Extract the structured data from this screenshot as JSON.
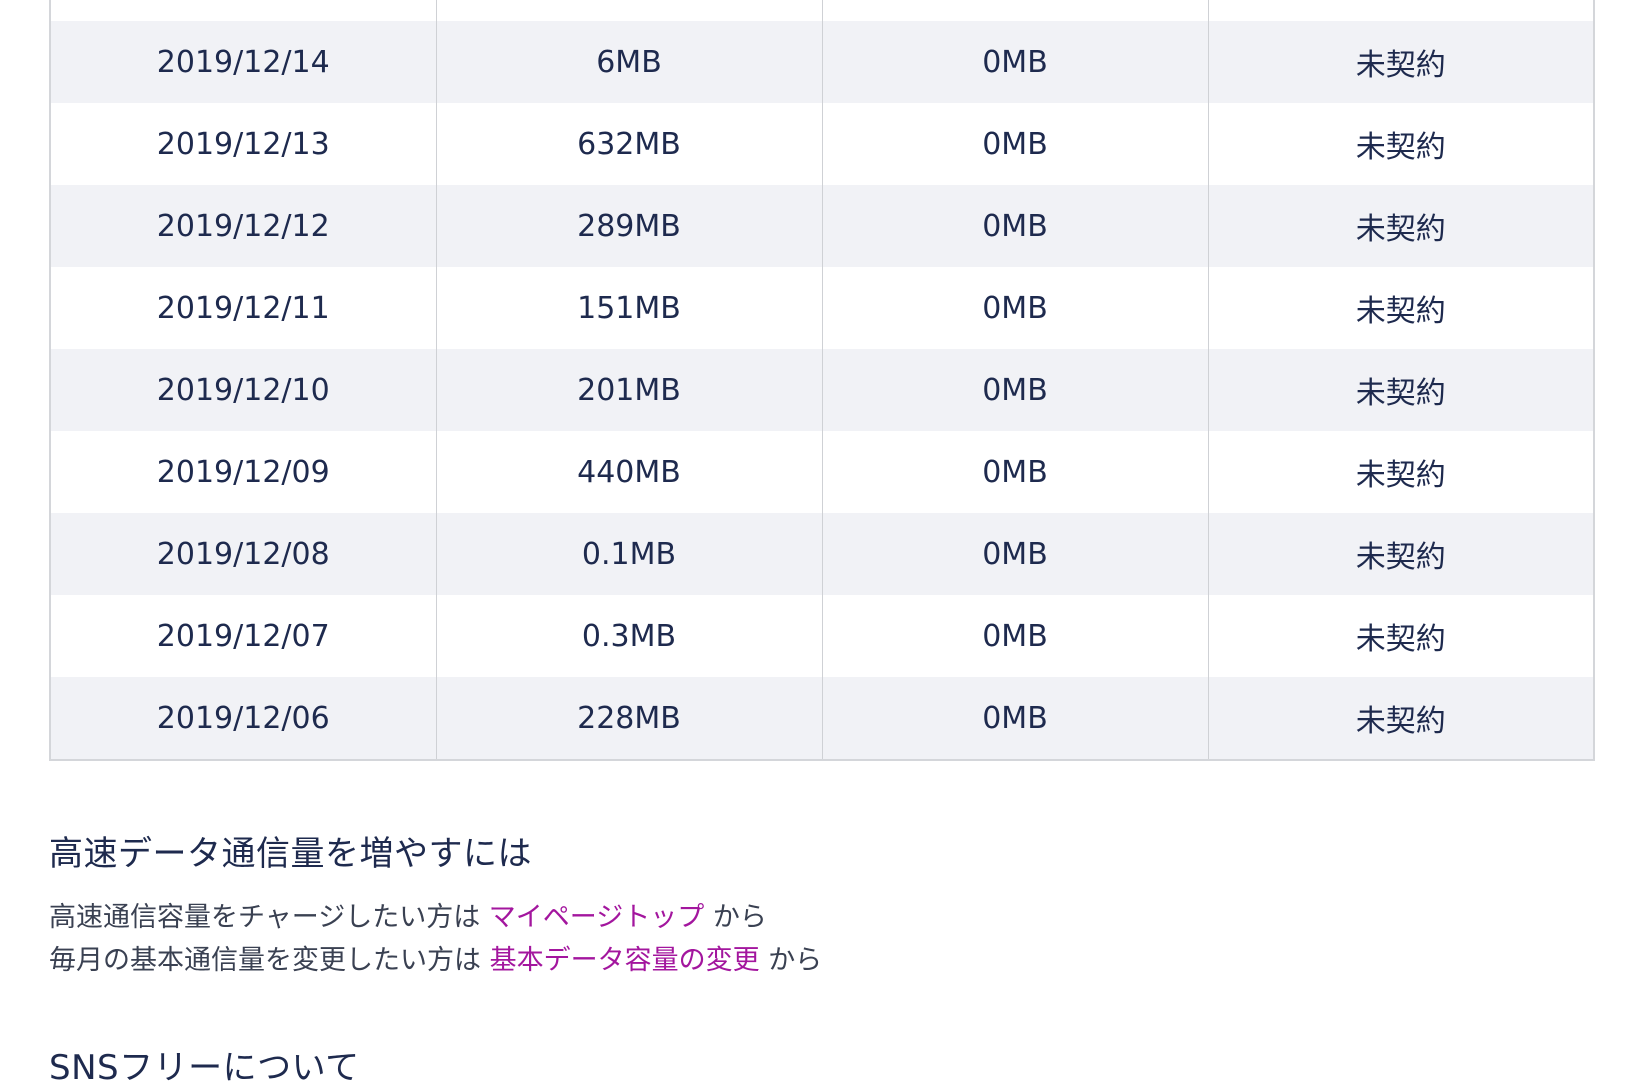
{
  "usage_table": {
    "rows": [
      {
        "date": "2019/12/14",
        "high_speed": "6MB",
        "sns_free": "0MB",
        "contract": "未契約"
      },
      {
        "date": "2019/12/13",
        "high_speed": "632MB",
        "sns_free": "0MB",
        "contract": "未契約"
      },
      {
        "date": "2019/12/12",
        "high_speed": "289MB",
        "sns_free": "0MB",
        "contract": "未契約"
      },
      {
        "date": "2019/12/11",
        "high_speed": "151MB",
        "sns_free": "0MB",
        "contract": "未契約"
      },
      {
        "date": "2019/12/10",
        "high_speed": "201MB",
        "sns_free": "0MB",
        "contract": "未契約"
      },
      {
        "date": "2019/12/09",
        "high_speed": "440MB",
        "sns_free": "0MB",
        "contract": "未契約"
      },
      {
        "date": "2019/12/08",
        "high_speed": "0.1MB",
        "sns_free": "0MB",
        "contract": "未契約"
      },
      {
        "date": "2019/12/07",
        "high_speed": "0.3MB",
        "sns_free": "0MB",
        "contract": "未契約"
      },
      {
        "date": "2019/12/06",
        "high_speed": "228MB",
        "sns_free": "0MB",
        "contract": "未契約"
      }
    ]
  },
  "increase_section": {
    "heading": "高速データ通信量を増やすには",
    "line1_prefix": "高速通信容量をチャージしたい方は",
    "line1_link": "マイページトップ",
    "line1_suffix": "から",
    "line2_prefix": "毎月の基本通信量を変更したい方は",
    "line2_link": "基本データ容量の変更",
    "line2_suffix": "から",
    "link_color": "#a3169e"
  },
  "sns_section": {
    "heading": "SNSフリーについて"
  }
}
